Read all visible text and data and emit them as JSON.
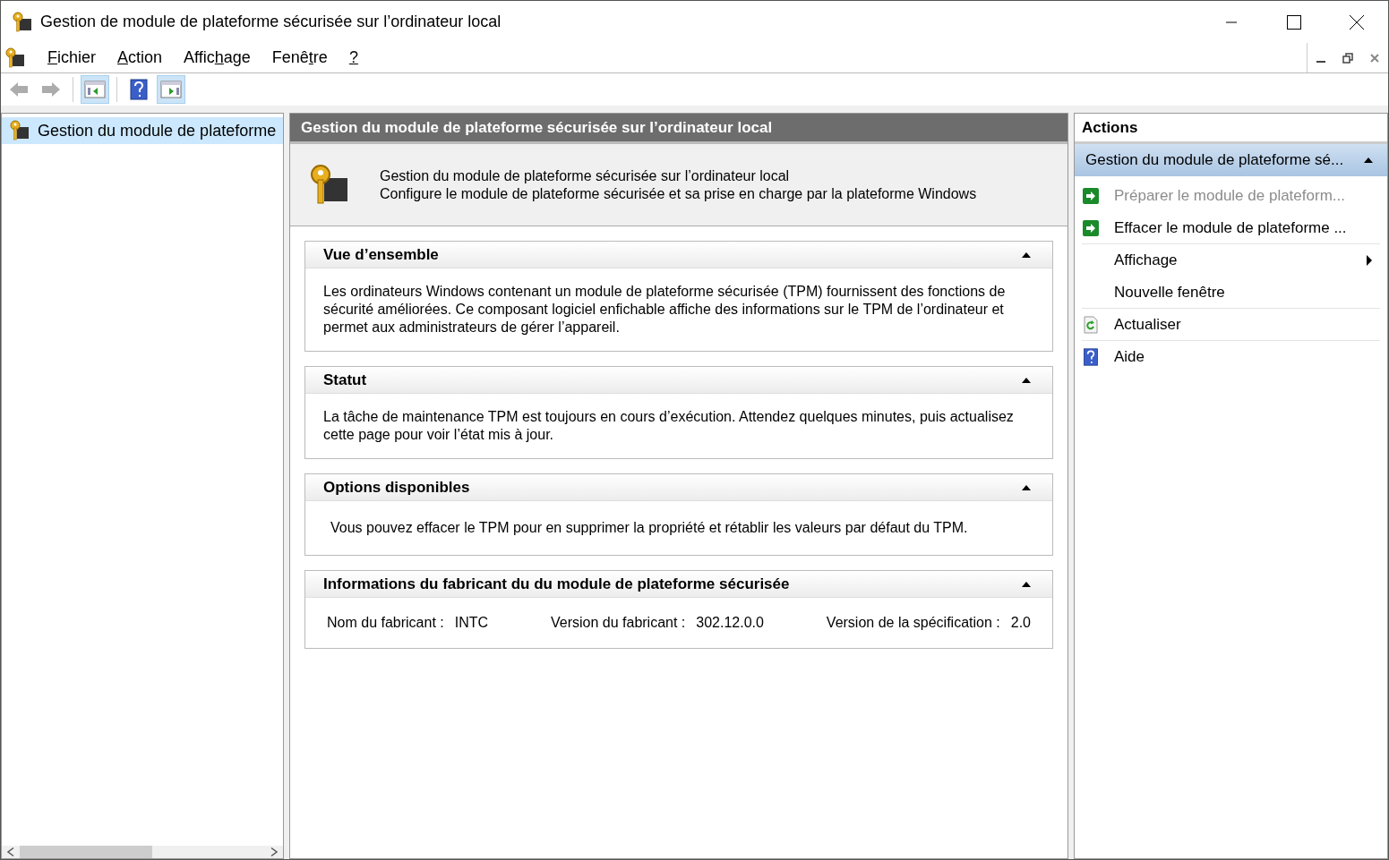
{
  "window": {
    "title": "Gestion de module de plateforme sécurisée sur l’ordinateur local"
  },
  "menu": [
    {
      "key": "F",
      "after": "ichier"
    },
    {
      "key": "A",
      "after": "ction"
    },
    {
      "before": "Affic",
      "key": "h",
      "after": "age"
    },
    {
      "before": "Fenê",
      "key": "t",
      "after": "re"
    },
    {
      "key": "?"
    }
  ],
  "toolbar": [
    {
      "kind": "back",
      "disabled": true
    },
    {
      "kind": "forward",
      "disabled": true
    },
    {
      "kind": "show-tree",
      "pressed": true
    },
    {
      "kind": "help",
      "pressed": false
    },
    {
      "kind": "show-actions",
      "pressed": true
    }
  ],
  "tree": {
    "items": [
      {
        "label": "Gestion du module de plateforme",
        "selected": true
      }
    ]
  },
  "content": {
    "title": "Gestion du module de plateforme sécurisée sur l’ordinateur local",
    "intro": [
      "Gestion du module de plateforme sécurisée sur l’ordinateur local",
      "Configure le module de plateforme sécurisée et sa prise en charge par la plateforme Windows"
    ],
    "sections": [
      {
        "kind": "text",
        "title": "Vue d’ensemble",
        "expanded": true,
        "body": "Les ordinateurs Windows contenant un module de plateforme sécurisée (TPM) fournissent des fonctions de sécurité améliorées. Ce composant logiciel enfichable affiche des informations sur le TPM de l’ordinateur et permet aux administrateurs de gérer l’appareil."
      },
      {
        "kind": "text",
        "title": "Statut",
        "expanded": true,
        "body": "La tâche de maintenance TPM est toujours en cours d’exécution. Attendez quelques minutes, puis actualisez cette page pour voir l’état mis à jour."
      },
      {
        "kind": "option",
        "title": "Options disponibles",
        "expanded": true,
        "body": "Vous pouvez effacer le TPM pour en supprimer la propriété et rétablir les valeurs par défaut du TPM."
      },
      {
        "kind": "fields",
        "title": "Informations du fabricant du du module de plateforme sécurisée",
        "expanded": true,
        "fields": [
          {
            "label": "Nom du fabricant :",
            "value": "INTC"
          },
          {
            "label": "Version du fabricant :",
            "value": "302.12.0.0"
          },
          {
            "label": "Version de la spécification :",
            "value": "2.0"
          }
        ]
      }
    ]
  },
  "actions": {
    "title": "Actions",
    "group": {
      "label": "Gestion du module de plateforme sé...",
      "expanded": true
    },
    "items": [
      {
        "label": "Préparer le module de plateform...",
        "kind": "task",
        "disabled": true,
        "submenu": false,
        "separator_after": false
      },
      {
        "label": "Effacer le module de plateforme ...",
        "kind": "task",
        "disabled": false,
        "submenu": false,
        "separator_after": true
      },
      {
        "label": "Affichage",
        "kind": "plain",
        "disabled": false,
        "submenu": true,
        "separator_after": false
      },
      {
        "label": "Nouvelle fenêtre",
        "kind": "plain",
        "disabled": false,
        "submenu": false,
        "separator_after": true
      },
      {
        "label": "Actualiser",
        "kind": "refresh",
        "disabled": false,
        "submenu": false,
        "separator_after": true
      },
      {
        "label": "Aide",
        "kind": "help",
        "disabled": false,
        "submenu": false,
        "separator_after": false
      }
    ]
  }
}
